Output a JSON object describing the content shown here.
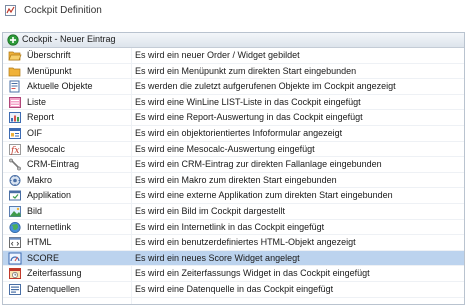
{
  "window": {
    "title": "Cockpit Definition",
    "icon": "app-icon"
  },
  "tree_header": {
    "label": "Cockpit - Neuer Eintrag",
    "icon": "plus-circle-icon"
  },
  "items": [
    {
      "name": "Überschrift",
      "desc": "Es wird ein neuer Order / Widget gebildet",
      "icon": "folder-open-icon"
    },
    {
      "name": "Menüpunkt",
      "desc": "Es wird ein Menüpunkt zum direkten Start eingebunden",
      "icon": "folder-icon"
    },
    {
      "name": "Aktuelle Objekte",
      "desc": "Es werden die zuletzt aufgerufenen Objekte im Cockpit angezeigt",
      "icon": "recent-objects-icon"
    },
    {
      "name": "Liste",
      "desc": "Es wird eine WinLine LIST-Liste in das Cockpit eingefügt",
      "icon": "list-icon"
    },
    {
      "name": "Report",
      "desc": "Es wird eine Report-Auswertung in das Cockpit eingefügt",
      "icon": "report-icon"
    },
    {
      "name": "OIF",
      "desc": "Es wird ein objektorientiertes Infoformular angezeigt",
      "icon": "oif-icon"
    },
    {
      "name": "Mesocalc",
      "desc": "Es wird eine Mesocalc-Auswertung eingefügt",
      "icon": "mesocalc-icon"
    },
    {
      "name": "CRM-Eintrag",
      "desc": "Es wird ein CRM-Eintrag zur direkten Fallanlage eingebunden",
      "icon": "crm-icon"
    },
    {
      "name": "Makro",
      "desc": "Es wird ein Makro zum direkten Start eingebunden",
      "icon": "macro-icon"
    },
    {
      "name": "Applikation",
      "desc": "Es wird eine externe Applikation zum direkten Start eingebunden",
      "icon": "application-icon"
    },
    {
      "name": "Bild",
      "desc": "Es wird ein Bild im Cockpit dargestellt",
      "icon": "image-icon"
    },
    {
      "name": "Internetlink",
      "desc": "Es wird ein Internetlink in das Cockpit eingefügt",
      "icon": "globe-icon"
    },
    {
      "name": "HTML",
      "desc": "Es wird ein benutzerdefiniertes HTML-Objekt angezeigt",
      "icon": "html-icon"
    },
    {
      "name": "SCORE",
      "desc": "Es wird ein neues Score Widget angelegt",
      "icon": "score-icon",
      "selected": true
    },
    {
      "name": "Zeiterfassung",
      "desc": "Es wird ein Zeiterfassungs Widget in das Cockpit eingefügt",
      "icon": "time-tracking-icon"
    },
    {
      "name": "Datenquellen",
      "desc": "Es wird eine Datenquelle in das Cockpit eingefügt",
      "icon": "datasource-icon"
    }
  ],
  "colors": {
    "selection": "#bcd3ee",
    "header": "#dde4ec",
    "border": "#b9c3cf"
  }
}
